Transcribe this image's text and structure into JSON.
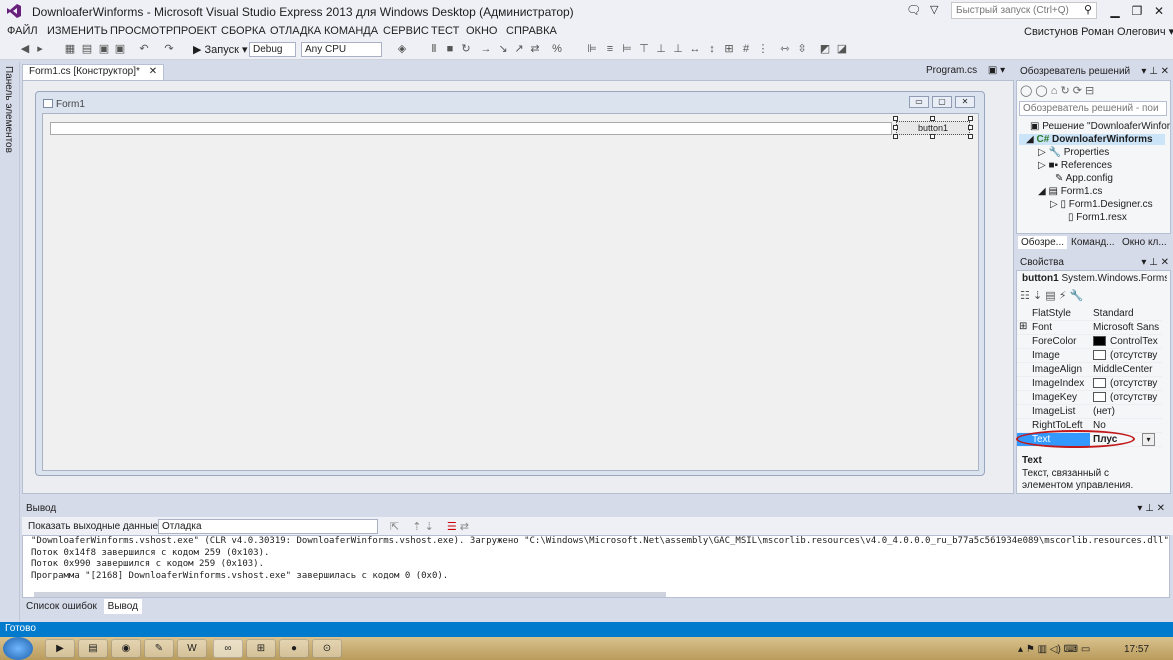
{
  "window": {
    "title": "DownloaferWinforms - Microsoft Visual Studio Express 2013 для Windows Desktop (Администратор)",
    "quick_launch_placeholder": "Быстрый запуск (Ctrl+Q)",
    "user": "Свистунов Роман Олегович ▾",
    "ctrl_min": "▁",
    "ctrl_max": "❐",
    "ctrl_close": "✕"
  },
  "menu": [
    "ФАЙЛ",
    "ИЗМЕНИТЬ",
    "ПРОСМОТР",
    "ПРОЕКТ",
    "СБОРКА",
    "ОТЛАДКА",
    "КОМАНДА",
    "СЕРВИС",
    "ТЕСТ",
    "ОКНО",
    "СПРАВКА"
  ],
  "toolbar": {
    "run_label": "▶ Запуск ▾",
    "config": "Debug",
    "platform": "Any CPU"
  },
  "left_strip_label": "Панель элементов",
  "doc_tabs": {
    "active": "Form1.cs [Конструктор]*",
    "active_close": "✕",
    "inactive": "Program.cs"
  },
  "designer": {
    "form_title": "Form1",
    "button_text": "button1",
    "btn_min": "▭",
    "btn_max": "▢",
    "btn_close": "✕"
  },
  "solution_explorer": {
    "title": "Обозреватель решений",
    "search_placeholder": "Обозреватель решений - пои",
    "items": [
      {
        "label": "Решение \"DownloaferWinfor"
      },
      {
        "label": "DownloaferWinforms"
      },
      {
        "label": "Properties"
      },
      {
        "label": "References"
      },
      {
        "label": "App.config"
      },
      {
        "label": "Form1.cs"
      },
      {
        "label": "Form1.Designer.cs"
      },
      {
        "label": "Form1.resx"
      }
    ],
    "tabs": [
      "Обозре...",
      "Команд...",
      "Окно кл..."
    ]
  },
  "properties": {
    "title": "Свойства",
    "object_name": "button1",
    "object_type": "System.Windows.Forms.B",
    "rows": [
      {
        "name": "FlatStyle",
        "value": "Standard"
      },
      {
        "name": "Font",
        "value": "Microsoft Sans S"
      },
      {
        "name": "ForeColor",
        "value": "ControlTex"
      },
      {
        "name": "Image",
        "value": "(отсутству"
      },
      {
        "name": "ImageAlign",
        "value": "MiddleCenter"
      },
      {
        "name": "ImageIndex",
        "value": "(отсутству"
      },
      {
        "name": "ImageKey",
        "value": "(отсутству"
      },
      {
        "name": "ImageList",
        "value": "(нет)"
      },
      {
        "name": "RightToLeft",
        "value": "No"
      },
      {
        "name": "Text",
        "value": "Плус"
      }
    ],
    "desc_title": "Text",
    "desc_text": "Текст, связанный с элементом управления."
  },
  "output": {
    "title": "Вывод",
    "source_label": "Показать выходные данные от:",
    "source_value": "Отладка",
    "lines": [
      "\"DownloaferWinforms.vshost.exe\" (CLR v4.0.30319: DownloaferWinforms.vshost.exe). Загружено \"C:\\Windows\\Microsoft.Net\\assembly\\GAC_MSIL\\mscorlib.resources\\v4.0_4.0.0.0_ru_b77a5c561934e089\\mscorlib.resources.dll\". Модуль",
      "Поток 0x14f8 завершился с кодом 259 (0x103).",
      "Поток 0x990 завершился с кодом 259 (0x103).",
      "Программа \"[2168] DownloaferWinforms.vshost.exe\" завершилась с кодом 0 (0x0)."
    ]
  },
  "bottom_tabs": [
    "Список ошибок",
    "Вывод"
  ],
  "status": "Готово",
  "taskbar": {
    "clock": "17:57"
  },
  "colors": {
    "accent": "#007acc",
    "annotation": "#c0181b"
  }
}
